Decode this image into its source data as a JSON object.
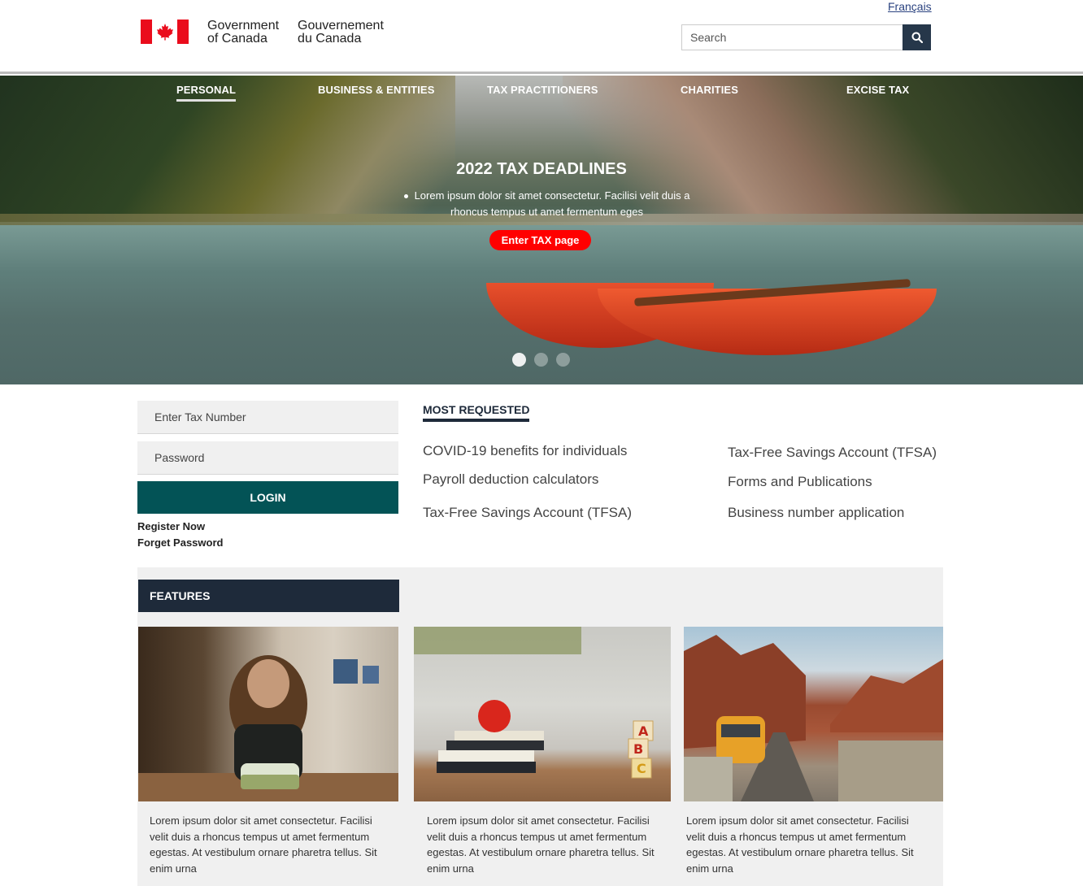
{
  "header": {
    "lang_link": "Français",
    "logo_en_line1": "Government",
    "logo_en_line2": "of Canada",
    "logo_fr_line1": "Gouvernement",
    "logo_fr_line2": "du Canada",
    "search_placeholder": "Search",
    "search_icon": "search-icon"
  },
  "nav": {
    "items": [
      {
        "label": "PERSONAL",
        "active": true
      },
      {
        "label": "BUSINESS & ENTITIES"
      },
      {
        "label": "TAX PRACTITIONERS"
      },
      {
        "label": "CHARITIES"
      },
      {
        "label": "EXCISE TAX"
      }
    ]
  },
  "hero": {
    "title": "2022 TAX DEADLINES",
    "text": "Lorem ipsum dolor sit amet consectetur. Facilisi velit duis a rhoncus tempus ut amet fermentum eges",
    "button": "Enter TAX page",
    "slides": 3,
    "active_slide": 1
  },
  "login": {
    "tax_number_placeholder": "Enter Tax Number",
    "password_placeholder": "Password",
    "button": "LOGIN",
    "register": "Register Now",
    "forgot": "Forget Password"
  },
  "most_requested": {
    "title": "MOST REQUESTED",
    "left": [
      "COVID-19 benefits for individuals",
      "Payroll deduction calculators",
      "Tax-Free Savings Account (TFSA)"
    ],
    "right": [
      "Tax-Free Savings Account (TFSA)",
      "Forms and Publications",
      "Business number application"
    ]
  },
  "features": {
    "title": "FEATURES",
    "cards": [
      {
        "text": "Lorem ipsum dolor sit amet consectetur. Facilisi velit duis a rhoncus tempus ut amet fermentum egestas. At vestibulum ornare pharetra tellus. Sit enim urna"
      },
      {
        "text": "Lorem ipsum dolor sit amet consectetur. Facilisi velit duis a rhoncus tempus ut amet fermentum egestas. At vestibulum ornare pharetra tellus. Sit enim urna"
      },
      {
        "text": "Lorem ipsum dolor sit amet consectetur. Facilisi velit duis a rhoncus tempus ut amet fermentum egestas. At vestibulum ornare pharetra tellus. Sit enim urna"
      }
    ]
  },
  "colors": {
    "flag_red": "#ea0c1c",
    "navy": "#1e2a3a",
    "teal": "#035356",
    "hero_button": "#ff0000"
  }
}
